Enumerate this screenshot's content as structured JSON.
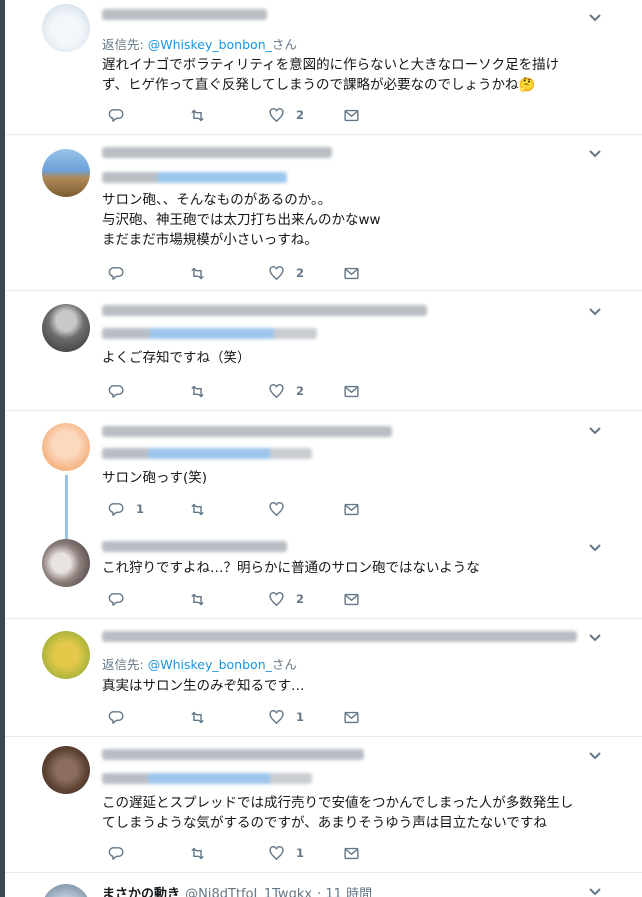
{
  "tweets": [
    {
      "reply_prefix": "返信先:",
      "reply_handle": "@Whiskey_bonbon_",
      "reply_suffix": "さん",
      "lines": [
        "遅れイナゴでボラティリティを意図的に作らないと大きなローソク足を描け",
        "ず、ヒゲ作って直ぐ反発してしまうので課略が必要なのでしょうかね🤔"
      ],
      "reply_count": "",
      "like_count": "2"
    },
    {
      "lines": [
        "サロン砲、、そんなものがあるのか。。",
        "与沢砲、神王砲では太刀打ち出来んのかなww",
        "まだまだ市場規模が小さいっすね。"
      ],
      "reply_count": "",
      "like_count": "2"
    },
    {
      "lines": [
        "よくご存知ですね（笑）"
      ],
      "reply_count": "",
      "like_count": "2"
    },
    {
      "lines": [
        "サロン砲っす(笑)"
      ],
      "reply_count": "1",
      "like_count": ""
    },
    {
      "lines": [
        "これ狩りですよね…？明らかに普通のサロン砲ではないような"
      ],
      "reply_count": "",
      "like_count": "2"
    },
    {
      "reply_prefix": "返信先:",
      "reply_handle": "@Whiskey_bonbon_",
      "reply_suffix": "さん",
      "lines": [
        "真実はサロン生のみぞ知るです…"
      ],
      "reply_count": "",
      "like_count": "1"
    },
    {
      "lines": [
        "この遅延とスプレッドでは成行売りで安値をつかんでしまった人が多数発生し",
        "てしまうような気がするのですが、あまりそうゆう声は目立たないですね"
      ],
      "reply_count": "",
      "like_count": "1"
    },
    {
      "name": "まさかの動き",
      "handle": "@Ni8dTtfoI_1Twgkx",
      "time": "· 11 時間"
    }
  ],
  "icons": {
    "reply": "reply-icon",
    "retweet": "retweet-icon",
    "like": "heart-icon",
    "dm": "mail-icon",
    "menu": "chevron-down-icon"
  },
  "colors": {
    "accent": "#1b95e0",
    "muted": "#657786",
    "border": "#e6ecf0",
    "thread": "#9ac3e8"
  }
}
